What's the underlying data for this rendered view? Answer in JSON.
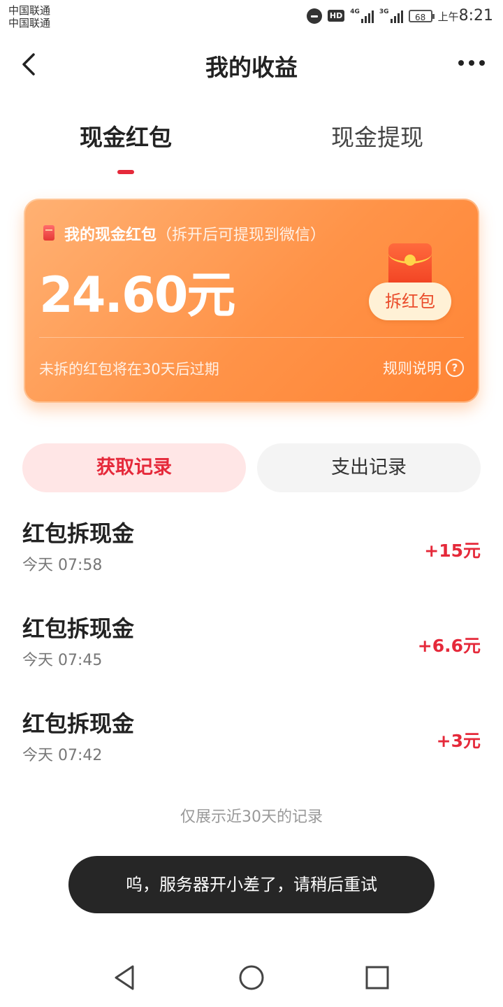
{
  "status_bar": {
    "carrier_line1": "中国联通",
    "carrier_line2": "中国联通",
    "hd": "HD",
    "net1": "4G",
    "net2": "3G",
    "battery": "68",
    "time_prefix": "上午",
    "time": "8:21"
  },
  "header": {
    "title": "我的收益",
    "back_icon": "chevron-left-icon",
    "more_icon": "more-horizontal-icon"
  },
  "tabs": [
    {
      "label": "现金红包",
      "active": true
    },
    {
      "label": "现金提现",
      "active": false
    }
  ],
  "card": {
    "title": "我的现金红包",
    "subtitle": "（拆开后可提现到微信）",
    "amount": "24.60元",
    "open_button": "拆红包",
    "expire_note": "未拆的红包将在30天后过期",
    "rules_label": "规则说明",
    "help_icon": "?",
    "colors": {
      "gradient_start": "#ffb173",
      "gradient_end": "#ff8435"
    }
  },
  "record_tabs": [
    {
      "label": "获取记录",
      "active": true
    },
    {
      "label": "支出记录",
      "active": false
    }
  ],
  "records": [
    {
      "title": "红包拆现金",
      "time": "今天 07:58",
      "amount": "+15元"
    },
    {
      "title": "红包拆现金",
      "time": "今天 07:45",
      "amount": "+6.6元"
    },
    {
      "title": "红包拆现金",
      "time": "今天 07:42",
      "amount": "+3元"
    }
  ],
  "footer_note": "仅展示近30天的记录",
  "toast": "呜，服务器开小差了，请稍后重试",
  "nav": {
    "back": "triangle-back-icon",
    "home": "circle-home-icon",
    "recents": "square-recents-icon"
  },
  "accent_color": "#e5293a"
}
